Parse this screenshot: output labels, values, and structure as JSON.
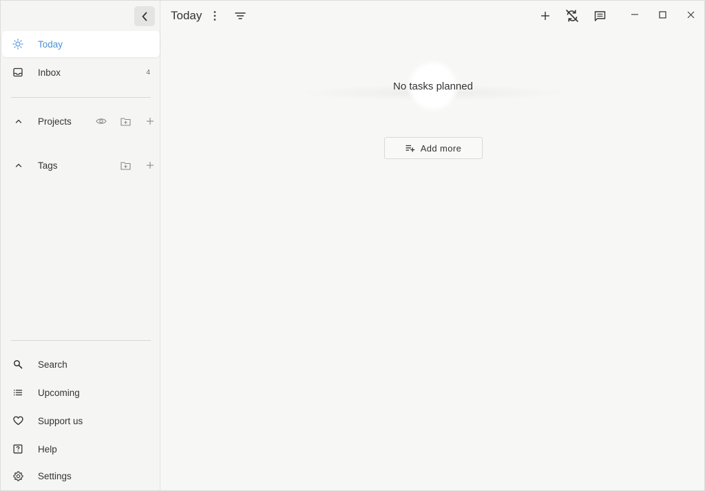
{
  "sidebar": {
    "nav": [
      {
        "label": "Today",
        "icon": "sun-icon",
        "active": true
      },
      {
        "label": "Inbox",
        "icon": "inbox-icon",
        "count": "4"
      }
    ],
    "projects": {
      "label": "Projects"
    },
    "tags": {
      "label": "Tags"
    },
    "bottom": [
      {
        "label": "Search",
        "icon": "search-icon"
      },
      {
        "label": "Upcoming",
        "icon": "list-icon"
      },
      {
        "label": "Support us",
        "icon": "heart-icon"
      },
      {
        "label": "Help",
        "icon": "help-icon"
      },
      {
        "label": "Settings",
        "icon": "gear-icon"
      }
    ]
  },
  "header": {
    "title": "Today"
  },
  "main": {
    "empty_text": "No tasks planned",
    "add_more_label": "Add more"
  },
  "colors": {
    "accent": "#4a90d9",
    "background": "#f7f7f5",
    "sidebar": "#f5f5f3"
  }
}
